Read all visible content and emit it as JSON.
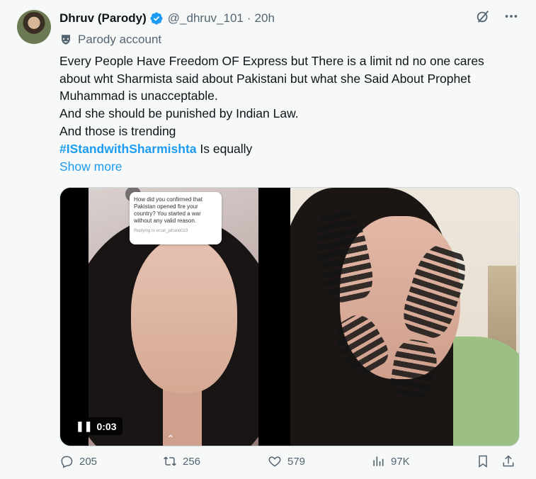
{
  "author": {
    "name": "Dhruv (Parody)",
    "handle": "@_dhruv_101",
    "separator": "·",
    "time": "20h",
    "label": "Parody account"
  },
  "body": {
    "lines": [
      "Every People Have Freedom OF Express but There is a limit nd no one cares",
      "about wht Sharmista said about Pakistani but what she Said About Prophet",
      "Muhammad is unacceptable.",
      "And she should be punished by Indian Law.",
      "And those is trending"
    ],
    "hashtag": "#IStandwithSharmishta",
    "hashtag_suffix": " Is equally",
    "show_more": "Show more"
  },
  "media": {
    "question_card": {
      "text": "How did you confirmed that Pakistan opened fire your country? You started a war without any valid reason.",
      "reply_to": "Replying to ersat_jahand023"
    },
    "video_duration": "0:03"
  },
  "actions": {
    "replies": "205",
    "reposts": "256",
    "likes": "579",
    "views": "97K"
  },
  "colors": {
    "link": "#1d9bf0",
    "muted": "#536471",
    "text": "#0f1419",
    "background": "#f7f9f9"
  },
  "icons": [
    "verified-badge-icon",
    "parody-mask-icon",
    "grok-icon",
    "more-icon",
    "pause-icon",
    "reply-icon",
    "repost-icon",
    "like-icon",
    "views-icon",
    "bookmark-icon",
    "share-icon"
  ]
}
